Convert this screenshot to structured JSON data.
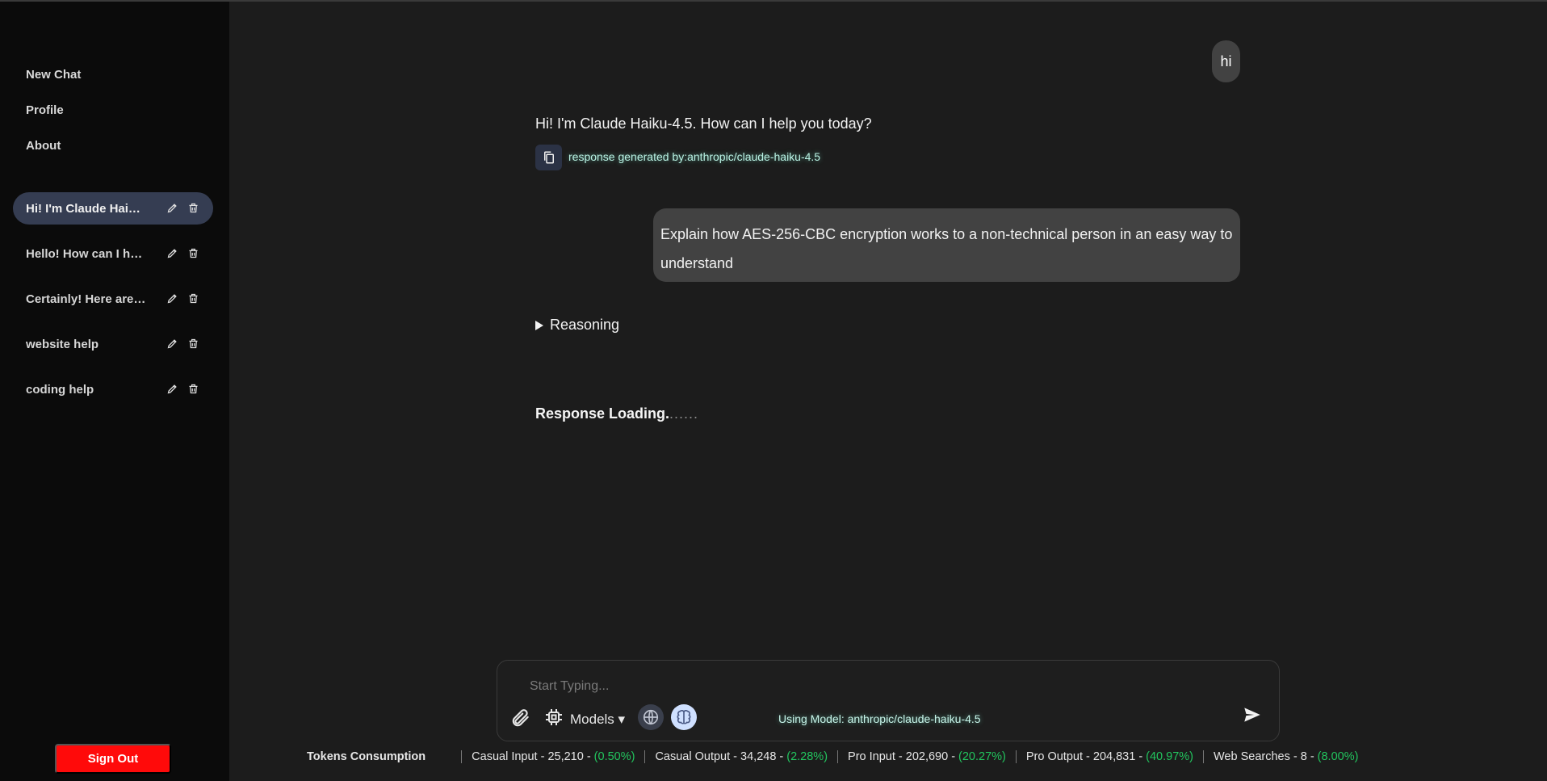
{
  "sidebar": {
    "nav": [
      "New Chat",
      "Profile",
      "About"
    ],
    "chats": [
      {
        "title": "Hi! I'm Claude Haiku...",
        "active": true
      },
      {
        "title": "Hello! How can I hel...",
        "active": false
      },
      {
        "title": "Certainly! Here are ...",
        "active": false
      },
      {
        "title": "website help",
        "active": false
      },
      {
        "title": "coding help",
        "active": false
      }
    ],
    "signout_label": "Sign Out"
  },
  "conversation": {
    "user_message_1": "hi",
    "assistant_message_1": "Hi! I'm Claude Haiku-4.5. How can I help you today?",
    "assistant_model_tag": "response generated by:anthropic/claude-haiku-4.5",
    "user_message_2": "Explain how AES-256-CBC encryption works to a non-technical person in an easy way to understand",
    "reasoning_label": "Reasoning",
    "loading_label": "Response Loading.",
    "loading_dots": "......"
  },
  "composer": {
    "placeholder": "Start Typing...",
    "models_label": "Models ▾",
    "using_model": "Using Model: anthropic/claude-haiku-4.5"
  },
  "tokens": {
    "heading": "Tokens Consumption",
    "items": [
      {
        "label": "Casual Input - 25,210 -",
        "pct": "(0.50%)"
      },
      {
        "label": "Casual Output - 34,248 -",
        "pct": "(2.28%)"
      },
      {
        "label": "Pro Input - 202,690 -",
        "pct": "(20.27%)"
      },
      {
        "label": "Pro Output - 204,831 -",
        "pct": "(40.97%)"
      },
      {
        "label": "Web Searches - 8 -",
        "pct": "(8.00%)"
      }
    ]
  },
  "colors": {
    "accent_active": "#353d52",
    "signout": "#ff0a0a",
    "percent_green": "#22c55e",
    "model_tag": "#b9f1e3"
  },
  "icons": [
    "edit-icon",
    "trash-icon",
    "copy-icon",
    "paperclip-icon",
    "chip-icon",
    "globe-icon",
    "brain-icon",
    "send-icon"
  ]
}
